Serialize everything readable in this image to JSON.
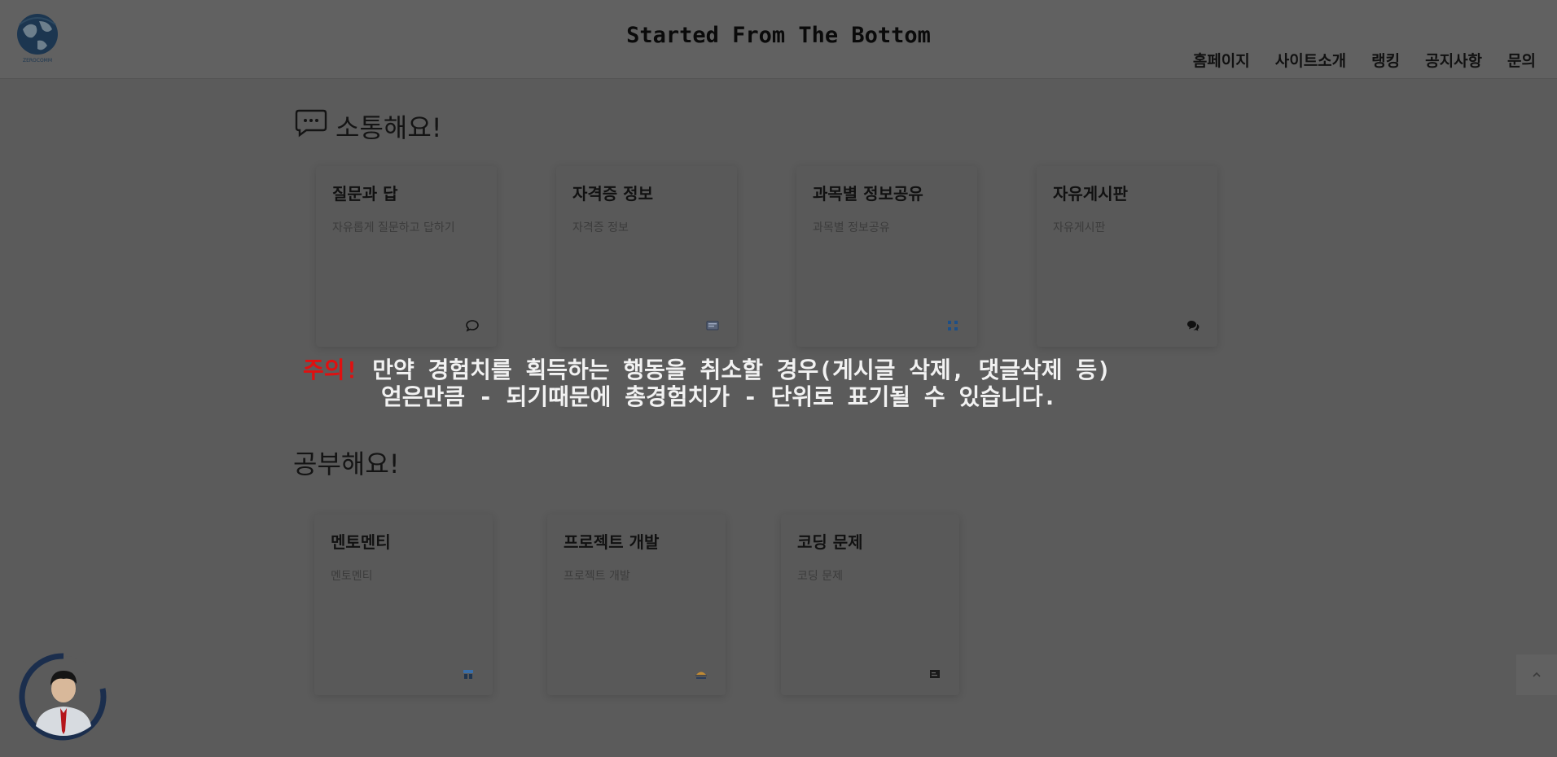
{
  "header": {
    "logo_text": "ZEROCOMM",
    "title": "Started From The Bottom",
    "nav": [
      "홈페이지",
      "사이트소개",
      "랭킹",
      "공지사항",
      "문의"
    ]
  },
  "community": {
    "title": "소통해요!",
    "cards": [
      {
        "title": "질문과 답",
        "desc": "자유롭게 질문하고 답하기",
        "icon": "comment-icon"
      },
      {
        "title": "자격증 정보",
        "desc": "자격증 정보",
        "icon": "certificate-icon"
      },
      {
        "title": "과목별 정보공유",
        "desc": "과목별 정보공유",
        "icon": "grid-icon"
      },
      {
        "title": "자유게시판",
        "desc": "자유게시판",
        "icon": "chat-bubbles-icon"
      }
    ]
  },
  "notice": {
    "label": "주의!",
    "line1": "만약 경험치를 획득하는 행동을 취소할 경우(게시글 삭제, 댓글삭제 등)",
    "line2": "얻은만큼 - 되기때문에 총경험치가 - 단위로 표기될 수 있습니다."
  },
  "study": {
    "title": "공부해요!",
    "cards": [
      {
        "title": "멘토멘티",
        "desc": "멘토멘티",
        "icon": "mentor-icon"
      },
      {
        "title": "프로젝트 개발",
        "desc": "프로젝트 개발",
        "icon": "project-icon"
      },
      {
        "title": "코딩 문제",
        "desc": "코딩 문제",
        "icon": "code-icon"
      }
    ]
  },
  "colors": {
    "background": "#5b5b5b",
    "warning": "#e01010",
    "notice_text": "#f2f2f2",
    "avatar_ring": "#1b2e4d"
  }
}
